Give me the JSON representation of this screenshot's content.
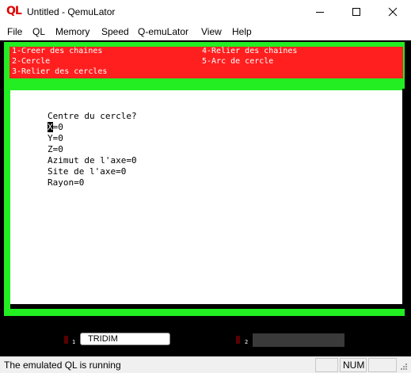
{
  "window": {
    "app_icon_text": "QL",
    "title": "Untitled - QemuLator",
    "minimize_icon": "minimize-icon",
    "maximize_icon": "maximize-icon",
    "close_icon": "close-icon"
  },
  "menu": {
    "items": [
      "File",
      "QL",
      "Memory",
      "Speed",
      "Q-emuLator",
      "View",
      "Help"
    ]
  },
  "ql_screen": {
    "colors": {
      "frame": "#22ee22",
      "menu_bg": "#ff1f1f",
      "panel_bg": "#ffffff",
      "background": "#000000"
    },
    "menu_options": [
      "1-Creer des chaines",
      "2-Cercle",
      "3-Relier des cercles",
      "4-Relier des chaines",
      "5-Arc de cercle"
    ],
    "prompt": "Centre du cercle?",
    "cursor_field": "X",
    "cursor_field_rest": "=0",
    "fields": [
      "Y=0",
      "Z=0",
      "Azimut de l'axe=0",
      "Site de l'axe=0",
      "Rayon=0"
    ]
  },
  "drives": {
    "slot1_number": "1",
    "slot1_label": "TRIDIM",
    "slot2_number": "2",
    "slot2_label": ""
  },
  "statusbar": {
    "message": "The emulated QL is running",
    "num_indicator": "NUM"
  }
}
